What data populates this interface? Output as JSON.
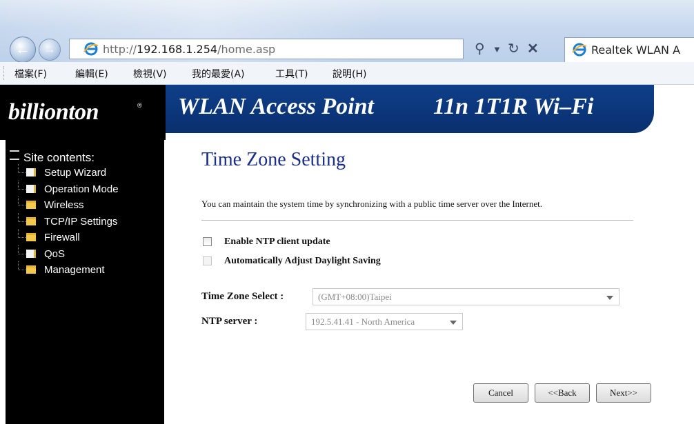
{
  "browser": {
    "address": {
      "prefix": "http://",
      "host": "192.168.1.254",
      "path": "/home.asp"
    },
    "tab_title": "Realtek WLAN A",
    "toolbar_icons": [
      "search-icon",
      "dropdown-icon",
      "refresh-icon",
      "stop-icon"
    ],
    "menu": [
      "檔案(F)",
      "編輯(E)",
      "檢視(V)",
      "我的最愛(A)",
      "工具(T)",
      "說明(H)"
    ]
  },
  "banner": {
    "logo": "billionton",
    "title": "WLAN Access Point",
    "subtitle": "11n  1T1R Wi–Fi"
  },
  "sidebar": {
    "heading": "Site contents:",
    "items": [
      {
        "label": "Setup Wizard",
        "icon": "document-icon"
      },
      {
        "label": "Operation Mode",
        "icon": "document-icon"
      },
      {
        "label": "Wireless",
        "icon": "folder-icon"
      },
      {
        "label": "TCP/IP Settings",
        "icon": "folder-icon"
      },
      {
        "label": "Firewall",
        "icon": "folder-icon"
      },
      {
        "label": "QoS",
        "icon": "document-icon"
      },
      {
        "label": "Management",
        "icon": "folder-icon"
      }
    ]
  },
  "main": {
    "heading": "Time Zone Setting",
    "description": "You can maintain the system time by synchronizing with a public time server over the Internet.",
    "enable_ntp": {
      "label": "Enable NTP client update",
      "checked": false
    },
    "daylight": {
      "label": "Automatically Adjust Daylight Saving",
      "checked": false,
      "disabled": true
    },
    "timezone": {
      "label": "Time Zone Select :",
      "value": "(GMT+08:00)Taipei"
    },
    "ntp_server": {
      "label": "NTP server :",
      "value": "192.5.41.41 - North America"
    },
    "buttons": {
      "cancel": "Cancel",
      "back": "<<Back",
      "next": "Next>>"
    }
  },
  "colors": {
    "banner_blue": "#0e3f8a",
    "heading_blue": "#1a2d8a",
    "nav_bg": "#000000"
  }
}
